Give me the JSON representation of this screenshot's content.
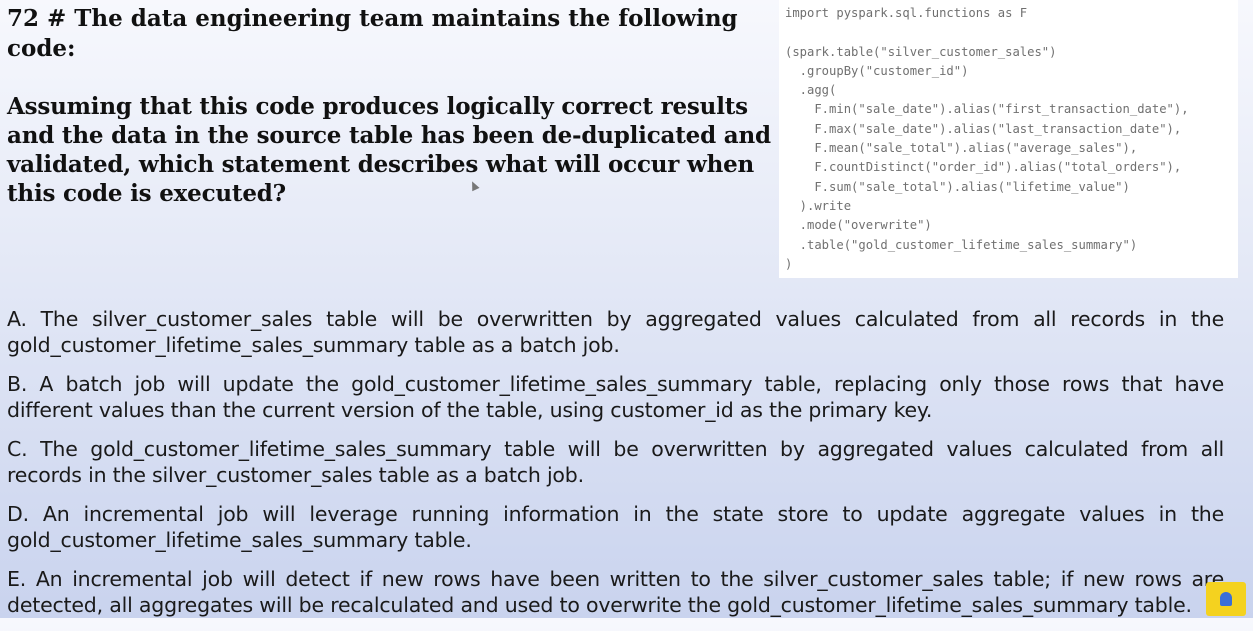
{
  "question": {
    "title": "72 # The data engineering team maintains the following code:",
    "body": "Assuming that this code produces logically correct results and the data in the source table has been de-duplicated and validated, which statement describes what will occur when this code is executed?"
  },
  "code": {
    "lines": [
      "import pyspark.sql.functions as F",
      "",
      "(spark.table(\"silver_customer_sales\")",
      "  .groupBy(\"customer_id\")",
      "  .agg(",
      "    F.min(\"sale_date\").alias(\"first_transaction_date\"),",
      "    F.max(\"sale_date\").alias(\"last_transaction_date\"),",
      "    F.mean(\"sale_total\").alias(\"average_sales\"),",
      "    F.countDistinct(\"order_id\").alias(\"total_orders\"),",
      "    F.sum(\"sale_total\").alias(\"lifetime_value\")",
      "  ).write",
      "  .mode(\"overwrite\")",
      "  .table(\"gold_customer_lifetime_sales_summary\")",
      ")"
    ]
  },
  "options": [
    {
      "text": "A. The silver_customer_sales table will be overwritten by aggregated values calculated from all records in the gold_customer_lifetime_sales_summary table as a batch job."
    },
    {
      "text": "B. A batch job will update the gold_customer_lifetime_sales_summary table, replacing only those rows that have different values than the current version of the table, using customer_id as the primary key."
    },
    {
      "text": "C. The gold_customer_lifetime_sales_summary table will be overwritten by aggregated values calculated from all records in the silver_customer_sales table as a batch job."
    },
    {
      "text": "D. An incremental job will leverage running information in the state store to update aggregate values in the gold_customer_lifetime_sales_summary table."
    },
    {
      "text": "E. An incremental job will detect if new rows have been written to the silver_customer_sales table; if new rows are detected, all aggregates will be recalculated and used to overwrite the gold_customer_lifetime_sales_summary table."
    }
  ],
  "logo": {
    "icon": "owl-logo-icon",
    "color": "#f4d21f"
  }
}
